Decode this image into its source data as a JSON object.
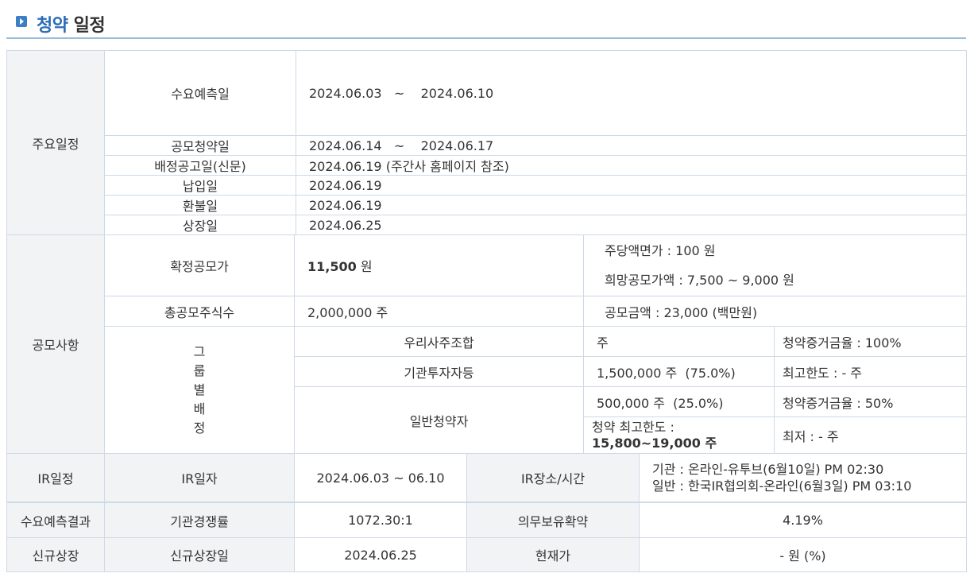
{
  "header": {
    "title_accent": "청약",
    "title_rest": " 일정"
  },
  "schedule": {
    "group_label": "주요일정",
    "rows": [
      {
        "label": "수요예측일",
        "value": "2024.06.03   ~    2024.06.10"
      },
      {
        "label": "공모청약일",
        "value": "2024.06.14   ~    2024.06.17"
      },
      {
        "label": "배정공고일(신문)",
        "value": "2024.06.19 (주간사 홈페이지 참조)"
      },
      {
        "label": "납입일",
        "value": "2024.06.19"
      },
      {
        "label": "환불일",
        "value": "2024.06.19"
      },
      {
        "label": "상장일",
        "value": "2024.06.25"
      }
    ]
  },
  "offering": {
    "group_label": "공모사항",
    "confirmed_price_label": "확정공모가",
    "confirmed_price_value": "11,500",
    "confirmed_price_unit": " 원",
    "par_value": "주당액면가 :  100 원",
    "hope_price": "희망공모가액 :  7,500 ~ 9,000 원",
    "total_shares_label": "총공모주식수",
    "total_shares_value": "2,000,000 주",
    "offering_amount": "공모금액 : 23,000 (백만원)",
    "group_alloc_label": [
      "그",
      "룹",
      "별",
      "배",
      "정"
    ],
    "employee_label": "우리사주조합",
    "employee_shares": "주",
    "employee_deposit": "청약증거금율 : 100%",
    "institution_label": "기관투자자등",
    "institution_shares": "1,500,000 주  (75.0%)",
    "institution_limit": "최고한도 :  - 주",
    "retail_label": "일반청약자",
    "retail_shares": "500,000 주  (25.0%)",
    "retail_deposit": "청약증거금율 : 50%",
    "retail_limit_label": "청약 최고한도 :",
    "retail_limit_value": "15,800~19,000 주",
    "retail_min": "최저 :  - 주"
  },
  "ir": {
    "group_label": "IR일정",
    "date_label": "IR일자",
    "date_value": "2024.06.03 ~ 06.10",
    "place_label": "IR장소/시간",
    "place_line1": "기관 : 온라인-유투브(6월10일) PM 02:30",
    "place_line2": "일반 : 한국IR협의회-온라인(6월3일) PM 03:10"
  },
  "demand": {
    "group_label": "수요예측결과",
    "comp_label": "기관경쟁률",
    "comp_value": "1072.30:1",
    "lockup_label": "의무보유확약",
    "lockup_value": "4.19%"
  },
  "listing": {
    "group_label": "신규상장",
    "date_label": "신규상장일",
    "date_value": "2024.06.25",
    "price_label": "현재가",
    "price_value": "- 원 (%)"
  }
}
